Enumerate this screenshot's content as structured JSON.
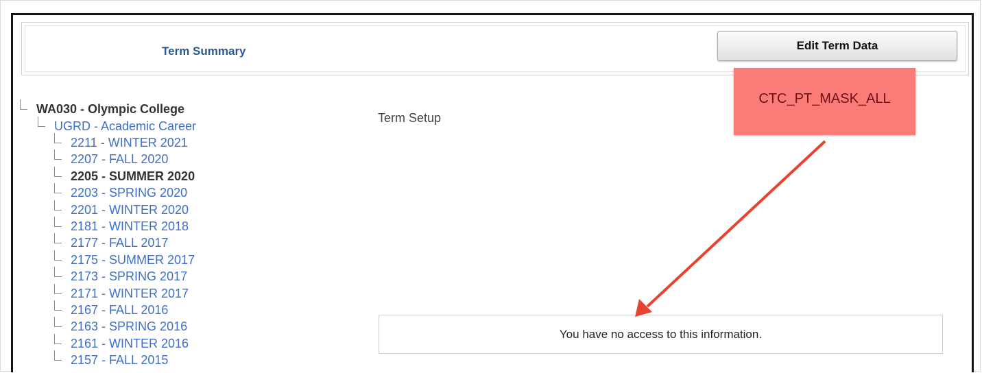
{
  "header": {
    "title": "Term Summary",
    "edit_button": "Edit Term Data"
  },
  "tree": {
    "root": "WA030 - Olympic College",
    "career": "UGRD - Academic Career",
    "terms": [
      {
        "label": "2211 - WINTER 2021",
        "current": false
      },
      {
        "label": "2207 - FALL 2020",
        "current": false
      },
      {
        "label": "2205 - SUMMER 2020",
        "current": true
      },
      {
        "label": "2203 - SPRING 2020",
        "current": false
      },
      {
        "label": "2201 - WINTER 2020",
        "current": false
      },
      {
        "label": "2181 - WINTER 2018",
        "current": false
      },
      {
        "label": "2177 - FALL 2017",
        "current": false
      },
      {
        "label": "2175 - SUMMER 2017",
        "current": false
      },
      {
        "label": "2173 - SPRING 2017",
        "current": false
      },
      {
        "label": "2171 - WINTER 2017",
        "current": false
      },
      {
        "label": "2167 - FALL 2016",
        "current": false
      },
      {
        "label": "2163 - SPRING 2016",
        "current": false
      },
      {
        "label": "2161 - WINTER 2016",
        "current": false
      },
      {
        "label": "2157 - FALL 2015",
        "current": false
      }
    ]
  },
  "main": {
    "section_title": "Term Setup",
    "message": "You have no access to this information."
  },
  "annotation": {
    "callout_text": "CTC_PT_MASK_ALL",
    "callout_color": "#fb7b78",
    "arrow_color": "#e8432e"
  },
  "colors": {
    "link": "#3d6fc8",
    "header_title": "#2a5a93"
  }
}
